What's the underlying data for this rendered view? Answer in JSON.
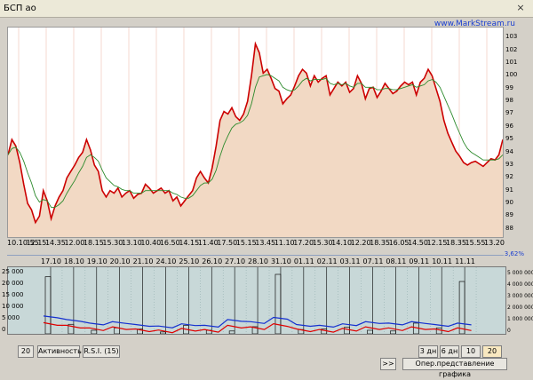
{
  "window": {
    "title": "БСП ао",
    "website": "www.MarkStream.ru",
    "close_glyph": "×"
  },
  "main_chart": {
    "y_ticks": [
      "103",
      "102",
      "101",
      "100",
      "99",
      "98",
      "97",
      "96",
      "95",
      "94",
      "93",
      "92",
      "91",
      "90",
      "89",
      "88"
    ],
    "x_ticks": [
      "10.10:55",
      "12.15",
      "14.35",
      "12.00",
      "18.15",
      "15.30",
      "13.10",
      "10.40",
      "16.50",
      "14.15",
      "11.40",
      "17.50",
      "15.15",
      "13.45",
      "11.10",
      "17.20",
      "15.30",
      "14.10",
      "12.20",
      "18.35",
      "16.05",
      "14.50",
      "12.15",
      "18.35",
      "15.55",
      "13.20"
    ],
    "accent": "#cc0000",
    "ma_color": "#2c8a2c",
    "fill_color": "#f2d9c4"
  },
  "chart_data": [
    {
      "type": "line",
      "title": "БСП ао",
      "ylim": [
        87.5,
        103.5
      ],
      "series": [
        {
          "values": [
            93.8,
            95,
            94.5,
            93.2,
            91.5,
            90,
            89.5,
            88.5,
            89,
            91,
            90.2,
            88.8,
            89.8,
            90.5,
            91,
            92,
            92.5,
            93,
            93.6,
            94,
            95,
            94.2,
            93,
            92.5,
            91,
            90.5,
            91,
            90.8,
            91.2,
            90.5,
            90.8,
            91,
            90.4,
            90.7,
            90.8,
            91.5,
            91.2,
            90.8,
            91,
            91.2,
            90.8,
            91,
            90.2,
            90.5,
            89.8,
            90.2,
            90.6,
            91,
            92,
            92.5,
            92,
            91.6,
            92.8,
            94.5,
            96.5,
            97.2,
            97,
            97.5,
            96.8,
            96.5,
            97,
            98,
            100,
            102.5,
            101.8,
            100.2,
            100.5,
            99.8,
            99,
            98.8,
            97.8,
            98.2,
            98.5,
            99.2,
            100,
            100.5,
            100.2,
            99.2,
            100,
            99.5,
            99.8,
            100,
            98.5,
            99,
            99.5,
            99.2,
            99.5,
            98.7,
            99,
            100,
            99.4,
            98.2,
            99,
            99.1,
            98.3,
            98.8,
            99.4,
            99,
            98.6,
            98.8,
            99.2,
            99.5,
            99.3,
            99.5,
            98.5,
            99.5,
            99.8,
            100.5,
            100,
            99,
            98,
            96.5,
            95.5,
            94.8,
            94.1,
            93.7,
            93.2,
            93,
            93.2,
            93.3,
            93.1,
            92.9,
            93.2,
            93.5,
            93.4,
            93.8,
            95
          ]
        },
        {
          "values": [
            93.8,
            94.3,
            94.4,
            94,
            93.3,
            92.4,
            91.6,
            90.6,
            90.1,
            90.3,
            90.2,
            89.7,
            89.7,
            89.9,
            90.2,
            90.8,
            91.3,
            91.8,
            92.4,
            92.9,
            93.6,
            93.8,
            93.6,
            93.3,
            92.6,
            92,
            91.7,
            91.4,
            91.3,
            91.1,
            91,
            91,
            90.8,
            90.8,
            90.8,
            91,
            91,
            91,
            91,
            91,
            91,
            91,
            90.8,
            90.7,
            90.5,
            90.4,
            90.4,
            90.6,
            91,
            91.4,
            91.6,
            91.6,
            91.9,
            92.6,
            93.7,
            94.6,
            95.3,
            95.9,
            96.2,
            96.3,
            96.5,
            96.9,
            97.8,
            99.1,
            99.9,
            100,
            100.1,
            100,
            99.8,
            99.6,
            99.1,
            98.9,
            98.8,
            98.9,
            99.2,
            99.6,
            99.8,
            99.6,
            99.7,
            99.7,
            99.7,
            99.8,
            99.4,
            99.3,
            99.4,
            99.3,
            99.4,
            99.2,
            99.1,
            99.4,
            99.4,
            99.1,
            99.1,
            99.1,
            98.9,
            98.9,
            99,
            99,
            98.9,
            98.9,
            99,
            99.1,
            99.2,
            99.3,
            99.1,
            99.2,
            99.3,
            99.6,
            99.7,
            99.5,
            99.1,
            98.4,
            97.7,
            97,
            96.2,
            95.5,
            94.8,
            94.3,
            94,
            93.8,
            93.6,
            93.4,
            93.4,
            93.4,
            93.4,
            93.5,
            93.8
          ]
        }
      ],
      "categories": [
        "10.10:55",
        "12.15",
        "14.35",
        "12.00",
        "18.15",
        "15.30",
        "13.10",
        "10.40",
        "16.50",
        "14.15",
        "11.40",
        "17.50",
        "15.15",
        "13.45",
        "11.10",
        "17.20",
        "15.30",
        "14.10",
        "12.20",
        "18.35",
        "16.05",
        "14.50",
        "12.15",
        "18.35",
        "15.55",
        "13.20"
      ]
    },
    {
      "type": "bar",
      "categories": [
        "17.10",
        "18.10",
        "19.10",
        "20.10",
        "21.10",
        "24.10",
        "25.10",
        "26.10",
        "27.10",
        "28.10",
        "31.10",
        "01.11",
        "02.11",
        "03.11",
        "07.11",
        "08.11",
        "09.11",
        "10.11",
        "11.11"
      ],
      "ylim": [
        0,
        25000
      ],
      "series": [
        {
          "values": [
            24000,
            4000,
            1500,
            2500,
            2000,
            800,
            3500,
            1500,
            1200,
            3000,
            25000,
            1800,
            2000,
            2800,
            1500,
            1200,
            4500,
            2500,
            22000
          ]
        },
        {
          "values": [
            2000,
            1500,
            1000,
            1200,
            800,
            600,
            900,
            700,
            1500,
            1200,
            1800,
            800,
            700,
            900,
            1200,
            1000,
            1200,
            800,
            1000
          ]
        }
      ]
    }
  ],
  "volume": {
    "left_ticks": [
      "25 000",
      "20 000",
      "15 000",
      "10 000",
      "5 000",
      "0"
    ],
    "right_ticks": [
      "5 000 000",
      "4 000 000",
      "3 000 000",
      "2 000 000",
      "1 000 000",
      "0"
    ],
    "pct": "3,62%"
  },
  "controls": {
    "period_value": "20",
    "activity_label": "Активность",
    "rsi_label": "R.S.I. (15)",
    "btn_3d": "3 дн",
    "btn_6d": "6 дн",
    "btn_10d": "10 дн",
    "btn_20d": "20 дн",
    "scroll_label": ">>",
    "oper_label": "Опер.представление графика"
  }
}
